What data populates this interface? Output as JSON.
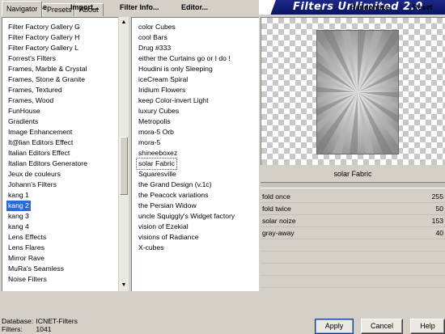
{
  "tabs": [
    "Navigator",
    "Presets",
    "About"
  ],
  "banner": {
    "title": "Filters Unlimited 2.0"
  },
  "categories": [
    "Filter Factory Gallery G",
    "Filter Factory Gallery H",
    "Filter Factory Gallery L",
    "Forrest's Filters",
    "Frames, Marble & Crystal",
    "Frames, Stone & Granite",
    "Frames, Textured",
    "Frames, Wood",
    "FunHouse",
    "Gradients",
    "Image Enhancement",
    "It@lian Editors Effect",
    "Italian Editors Effect",
    "Italian Editors Generatore",
    "Jeux de couleurs",
    "Johann's Filters",
    "kang 1",
    "kang 2",
    "kang 3",
    "kang 4",
    "Lens Effects",
    "Lens Flares",
    "Mirror Rave",
    "MuRa's Seamless",
    "Noise Filters"
  ],
  "selected_category": "kang 2",
  "filters": [
    "color Cubes",
    "cool Bars",
    "Drug #333",
    "either the Curtains go or I do !",
    "Houdini is only Sleeping",
    "iceCream Spiral",
    "Iridium Flowers",
    "keep Color-invert Light",
    "luxury Cubes",
    "Metropolis",
    "mora-5 Orb",
    "mora-5",
    "shineeboxez",
    "solar Fabric",
    "Squaresville",
    "the Grand Design     (v.1c)",
    "the Peacock variations",
    "the Persian Widow",
    "uncle Squiggly's Widget factory",
    "vision of Ezekial",
    "visions of Radiance",
    "X-cubes"
  ],
  "selected_filter": "solar Fabric",
  "filter_name": "solar Fabric",
  "params": [
    {
      "label": "fold once",
      "value": "255"
    },
    {
      "label": "fold twice",
      "value": "50"
    },
    {
      "label": "solar noize",
      "value": "153"
    },
    {
      "label": "gray-away",
      "value": "40"
    }
  ],
  "toolbar": {
    "database": "Database",
    "import": "Import...",
    "filter_info": "Filter Info...",
    "editor": "Editor...",
    "randomize": "Randomize",
    "reset": "Reset"
  },
  "status": {
    "database_key": "Database:",
    "database_value": "ICNET-Filters",
    "filters_key": "Filters:",
    "filters_value": "1041"
  },
  "buttons": {
    "apply": "Apply",
    "cancel": "Cancel",
    "help": "Help"
  },
  "colors": {
    "selection": "#2a6bd4",
    "banner": "#1d2a8c",
    "background": "#d4d0c8"
  }
}
